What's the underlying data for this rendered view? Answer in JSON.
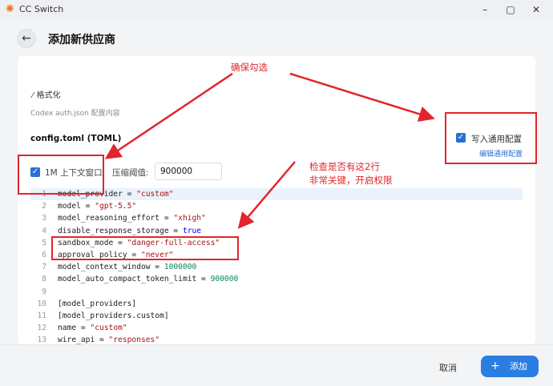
{
  "window": {
    "title": "CC Switch",
    "icon": "app-logo-icon",
    "minimize": "–",
    "maximize": "▢",
    "close": "✕"
  },
  "header": {
    "back": "←",
    "title": "添加新供应商"
  },
  "form": {
    "format_button": "格式化",
    "auth_label": "Codex auth.json 配置内容",
    "toml_label": "config.toml (TOML)",
    "context_checkbox_label": "1M 上下文窗口",
    "context_checked": true,
    "threshold_label": "压缩阈值:",
    "threshold_value": "900000",
    "write_common_label": "写入通用配置",
    "write_common_checked": true,
    "edit_common_link": "编辑通用配置"
  },
  "editor": {
    "lines": [
      {
        "n": "1",
        "code": "model_provider = \"custom\""
      },
      {
        "n": "2",
        "code": "model = \"gpt-5.5\""
      },
      {
        "n": "3",
        "code": "model_reasoning_effort = \"xhigh\""
      },
      {
        "n": "4",
        "code": "disable_response_storage = true"
      },
      {
        "n": "5",
        "code": "sandbox_mode = \"danger-full-access\""
      },
      {
        "n": "6",
        "code": "approval_policy = \"never\""
      },
      {
        "n": "7",
        "code": "model_context_window = 1000000"
      },
      {
        "n": "8",
        "code": "model_auto_compact_token_limit = 900000"
      },
      {
        "n": "9",
        "code": ""
      },
      {
        "n": "10",
        "code": "[model_providers]"
      },
      {
        "n": "11",
        "code": "[model_providers.custom]"
      },
      {
        "n": "12",
        "code": "name = \"custom\""
      },
      {
        "n": "13",
        "code": "wire_api = \"responses\""
      }
    ]
  },
  "footer": {
    "cancel": "取消",
    "add": "添加",
    "add_icon": "+"
  },
  "annotations": {
    "ensure_checked": "确保勾选",
    "check_line1": "检查是否有这2行",
    "check_line2": "非常关键，开启权限",
    "color": "#e3242b"
  },
  "colors": {
    "accent": "#2a7de1",
    "string": "#a31515",
    "number": "#098658",
    "keyword": "#0000ff"
  }
}
